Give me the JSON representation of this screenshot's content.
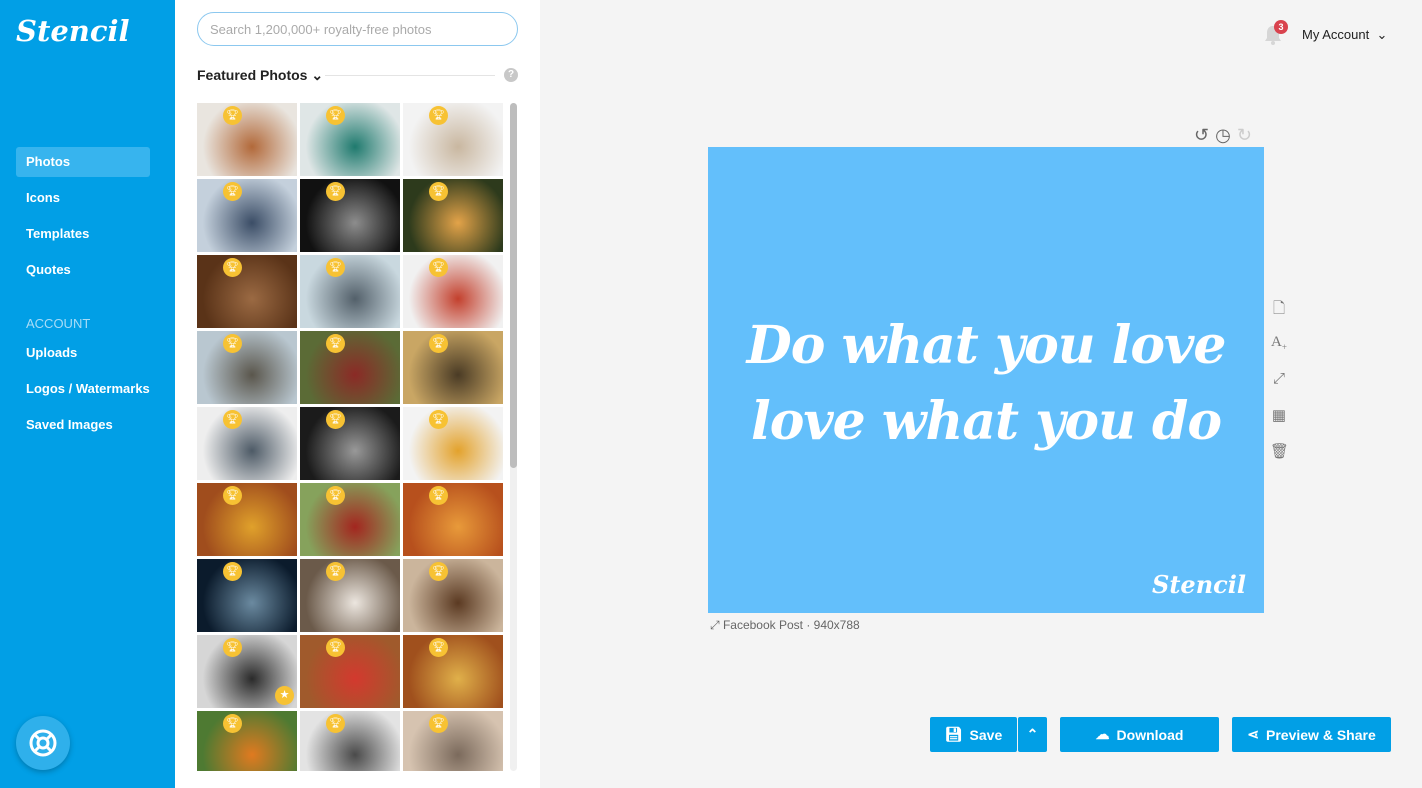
{
  "brand": "Stencil",
  "sidebar": {
    "items": [
      {
        "label": "Photos",
        "active": true
      },
      {
        "label": "Icons"
      },
      {
        "label": "Templates"
      },
      {
        "label": "Quotes"
      }
    ],
    "account_heading": "ACCOUNT",
    "account_items": [
      {
        "label": "Uploads"
      },
      {
        "label": "Logos / Watermarks"
      },
      {
        "label": "Saved Images"
      }
    ]
  },
  "panel": {
    "search_placeholder": "Search 1,200,000+ royalty-free photos",
    "section": "Featured Photos",
    "photos": [
      [
        "#e9e5df",
        "#b2693a"
      ],
      [
        "#dfe6e6",
        "#1f7a6e"
      ],
      [
        "#f3f3f3",
        "#c9b7a0"
      ],
      [
        "#c4d0dc",
        "#3b4d66"
      ],
      [
        "#111111",
        "#8d8d8d"
      ],
      [
        "#2d3a1c",
        "#e3a349"
      ],
      [
        "#5a3318",
        "#9b6a43"
      ],
      [
        "#c9d8df",
        "#53606a"
      ],
      [
        "#f1f1f1",
        "#c3402d"
      ],
      [
        "#b9c7d0",
        "#5a564c"
      ],
      [
        "#5b6b36",
        "#8b2a26"
      ],
      [
        "#c9a664",
        "#4a3b25"
      ],
      [
        "#eeeeee",
        "#4d5a66"
      ],
      [
        "#1b1b1b",
        "#999999"
      ],
      [
        "#f3f3f3",
        "#e3a22c"
      ],
      [
        "#a04d1d",
        "#e0a12b"
      ],
      [
        "#86a25c",
        "#a3261f"
      ],
      [
        "#b7501d",
        "#e89a3a"
      ],
      [
        "#0b1b2c",
        "#6b8aa0"
      ],
      [
        "#6b5a4a",
        "#ece6df"
      ],
      [
        "#cbb59c",
        "#5b3a22"
      ],
      [
        "#d6d6d6",
        "#2a2a2a"
      ],
      [
        "#a05a2c",
        "#d3392e"
      ],
      [
        "#a0501d",
        "#e0b04a"
      ],
      [
        "#4e7a32",
        "#e07a20"
      ],
      [
        "#e3e3e3",
        "#4a4a4a"
      ],
      [
        "#d6c3b0",
        "#7b6a5c"
      ]
    ],
    "starred_index": 21
  },
  "header": {
    "notifications": "3",
    "account": "My Account"
  },
  "canvas": {
    "line1": "Do what you love",
    "line2": "love what you do",
    "watermark": "Stencil",
    "background": "#63bffb",
    "size_label": "Facebook Post · 940x788"
  },
  "actions": {
    "save": "Save",
    "download": "Download",
    "share": "Preview & Share"
  },
  "colors": {
    "brand": "#019fe6",
    "badge": "#f7c233"
  }
}
